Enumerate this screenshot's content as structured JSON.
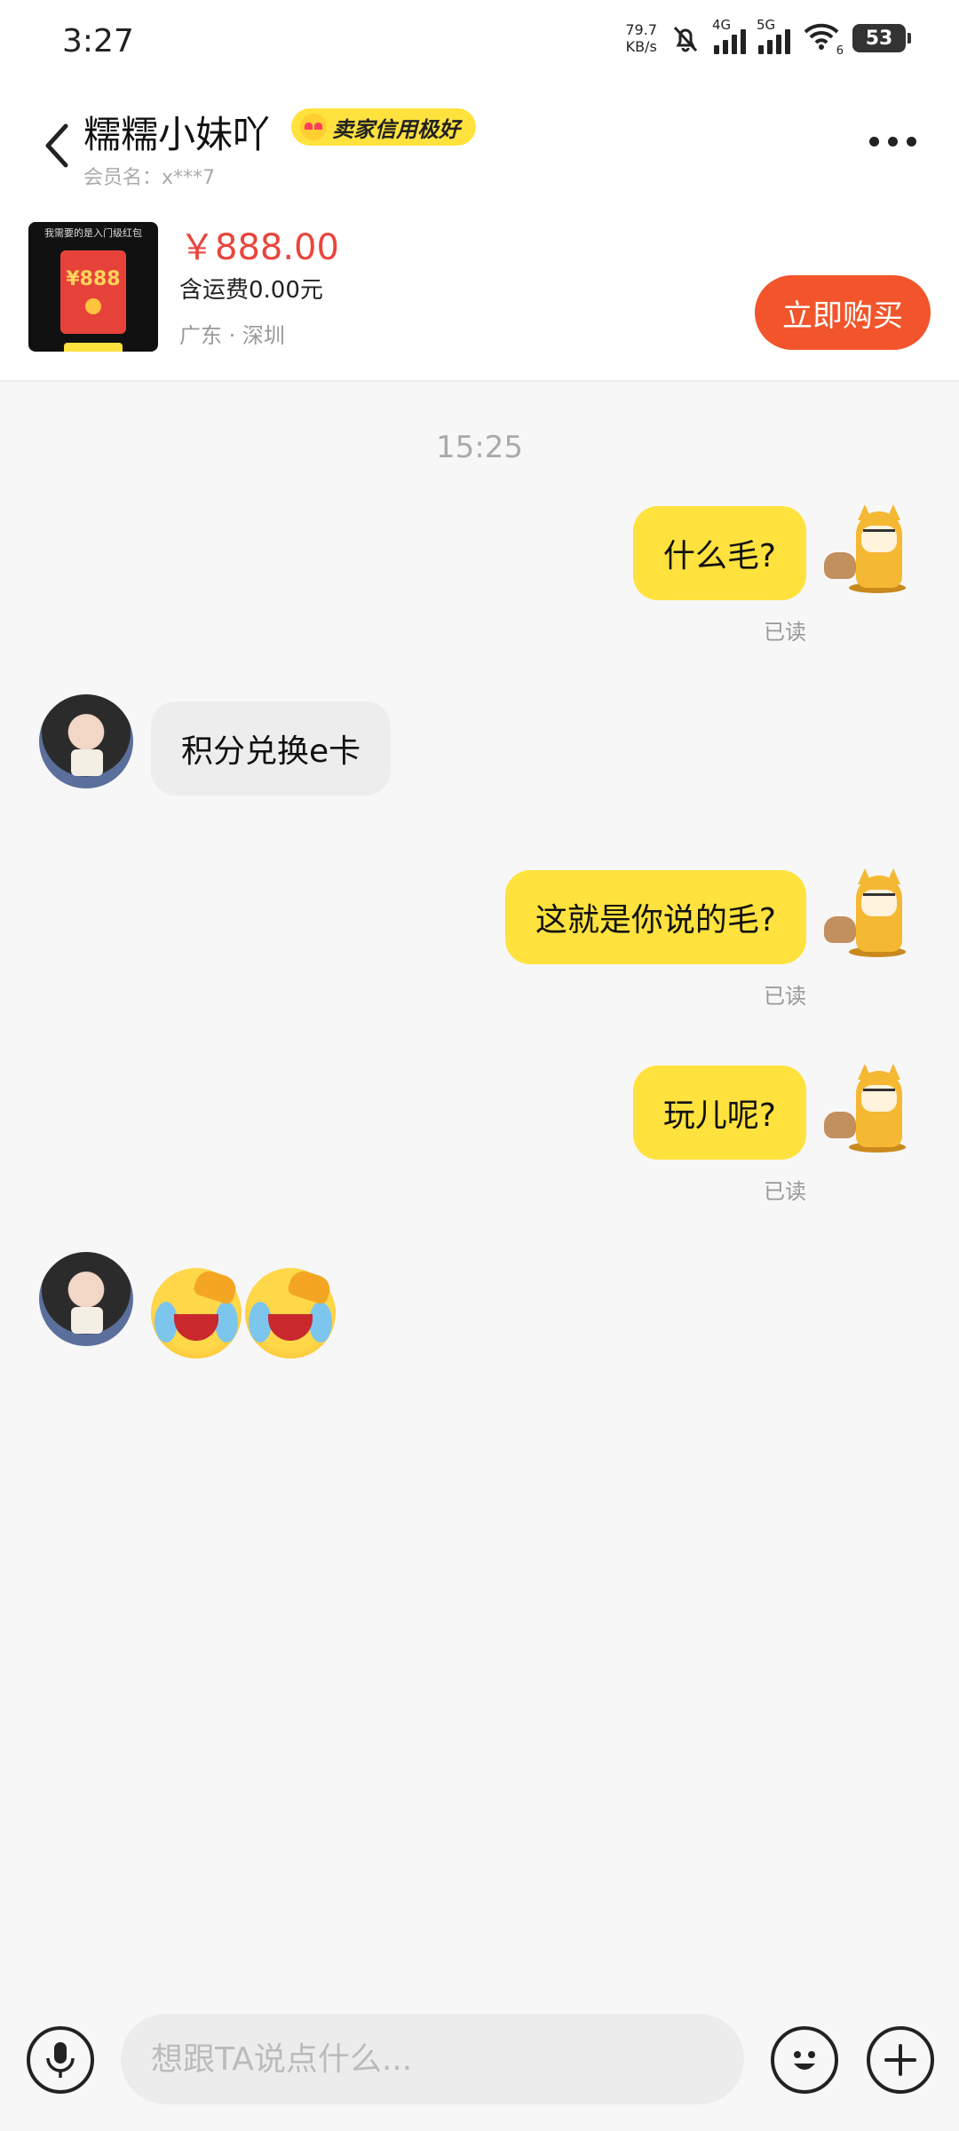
{
  "status_bar": {
    "time": "3:27",
    "net_speed_value": "79.7",
    "net_speed_unit": "KB/s",
    "sim1_label": "4G",
    "sim2_label": "5G",
    "wifi_badge": "6",
    "battery": "53"
  },
  "header": {
    "seller_name": "糯糯小妹吖",
    "credit_badge": "卖家信用极好",
    "member_name": "会员名：x***7"
  },
  "product": {
    "thumb_caption": "我需要的是入门级红包",
    "thumb_amount": "¥888",
    "price": "￥888.00",
    "shipping": "含运费0.00元",
    "location": "广东 · 深圳",
    "buy_label": "立即购买"
  },
  "chat": {
    "timestamp": "15:25",
    "messages": [
      {
        "from": "me",
        "text": "什么毛?",
        "status": "已读"
      },
      {
        "from": "seller",
        "text": "积分兑换e卡"
      },
      {
        "from": "me",
        "text": "这就是你说的毛?",
        "status": "已读"
      },
      {
        "from": "me",
        "text": "玩儿呢?",
        "status": "已读"
      },
      {
        "from": "seller",
        "emoji": [
          "facepalm-laugh-cry",
          "facepalm-laugh-cry"
        ]
      }
    ]
  },
  "input": {
    "placeholder": "想跟TA说点什么..."
  },
  "icons": {
    "back": "back-arrow-icon",
    "more": "more-dots-icon",
    "voice": "microphone-icon",
    "emoji": "smiley-icon",
    "plus": "plus-icon"
  },
  "colors": {
    "accent_yellow": "#ffe23d",
    "buy_button": "#f2552b",
    "price_red": "#e8463c",
    "incoming_bubble": "#ededed"
  }
}
